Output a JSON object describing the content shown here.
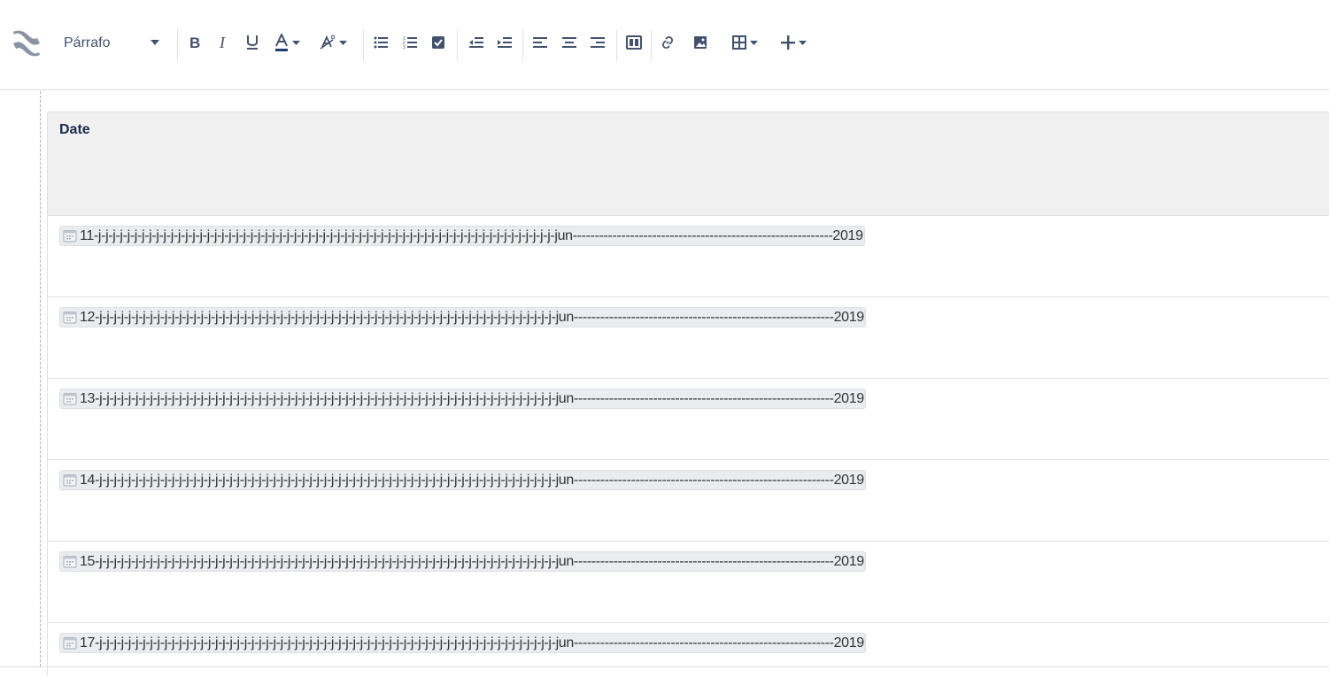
{
  "toolbar": {
    "paragraph_style": "Párrafo"
  },
  "table": {
    "header": "Date",
    "rows": [
      {
        "date": "11-j-j-j-j-j-j-j-j-j-j-j-j-j-j-j-j-j-j-j-j-j-j-j-j-j-j-j-j-j-j-j-j-j-j-j-j-j-j-j-j-j-j-j-j-j-j-j-j-j-j-j-j-j-j-j-j-j-j-j-j-j-j-j-jun-----------------------------------------------------------2019"
      },
      {
        "date": "12-j-j-j-j-j-j-j-j-j-j-j-j-j-j-j-j-j-j-j-j-j-j-j-j-j-j-j-j-j-j-j-j-j-j-j-j-j-j-j-j-j-j-j-j-j-j-j-j-j-j-j-j-j-j-j-j-j-j-j-j-j-j-j-jun-----------------------------------------------------------2019"
      },
      {
        "date": "13-j-j-j-j-j-j-j-j-j-j-j-j-j-j-j-j-j-j-j-j-j-j-j-j-j-j-j-j-j-j-j-j-j-j-j-j-j-j-j-j-j-j-j-j-j-j-j-j-j-j-j-j-j-j-j-j-j-j-j-j-j-j-j-jun-----------------------------------------------------------2019"
      },
      {
        "date": "14-j-j-j-j-j-j-j-j-j-j-j-j-j-j-j-j-j-j-j-j-j-j-j-j-j-j-j-j-j-j-j-j-j-j-j-j-j-j-j-j-j-j-j-j-j-j-j-j-j-j-j-j-j-j-j-j-j-j-j-j-j-j-j-jun-----------------------------------------------------------2019"
      },
      {
        "date": "15-j-j-j-j-j-j-j-j-j-j-j-j-j-j-j-j-j-j-j-j-j-j-j-j-j-j-j-j-j-j-j-j-j-j-j-j-j-j-j-j-j-j-j-j-j-j-j-j-j-j-j-j-j-j-j-j-j-j-j-j-j-j-j-jun-----------------------------------------------------------2019"
      },
      {
        "date": "17-j-j-j-j-j-j-j-j-j-j-j-j-j-j-j-j-j-j-j-j-j-j-j-j-j-j-j-j-j-j-j-j-j-j-j-j-j-j-j-j-j-j-j-j-j-j-j-j-j-j-j-j-j-j-j-j-j-j-j-j-j-j-j-jun-----------------------------------------------------------2019"
      }
    ]
  },
  "icons": {
    "logo": "confluence-logo-icon",
    "calendar": "calendar-icon"
  },
  "colors": {
    "icon": "#42526e",
    "header_bg": "#f0f0f0",
    "lozenge_bg": "#ebecf0",
    "text": "#172b4d"
  }
}
